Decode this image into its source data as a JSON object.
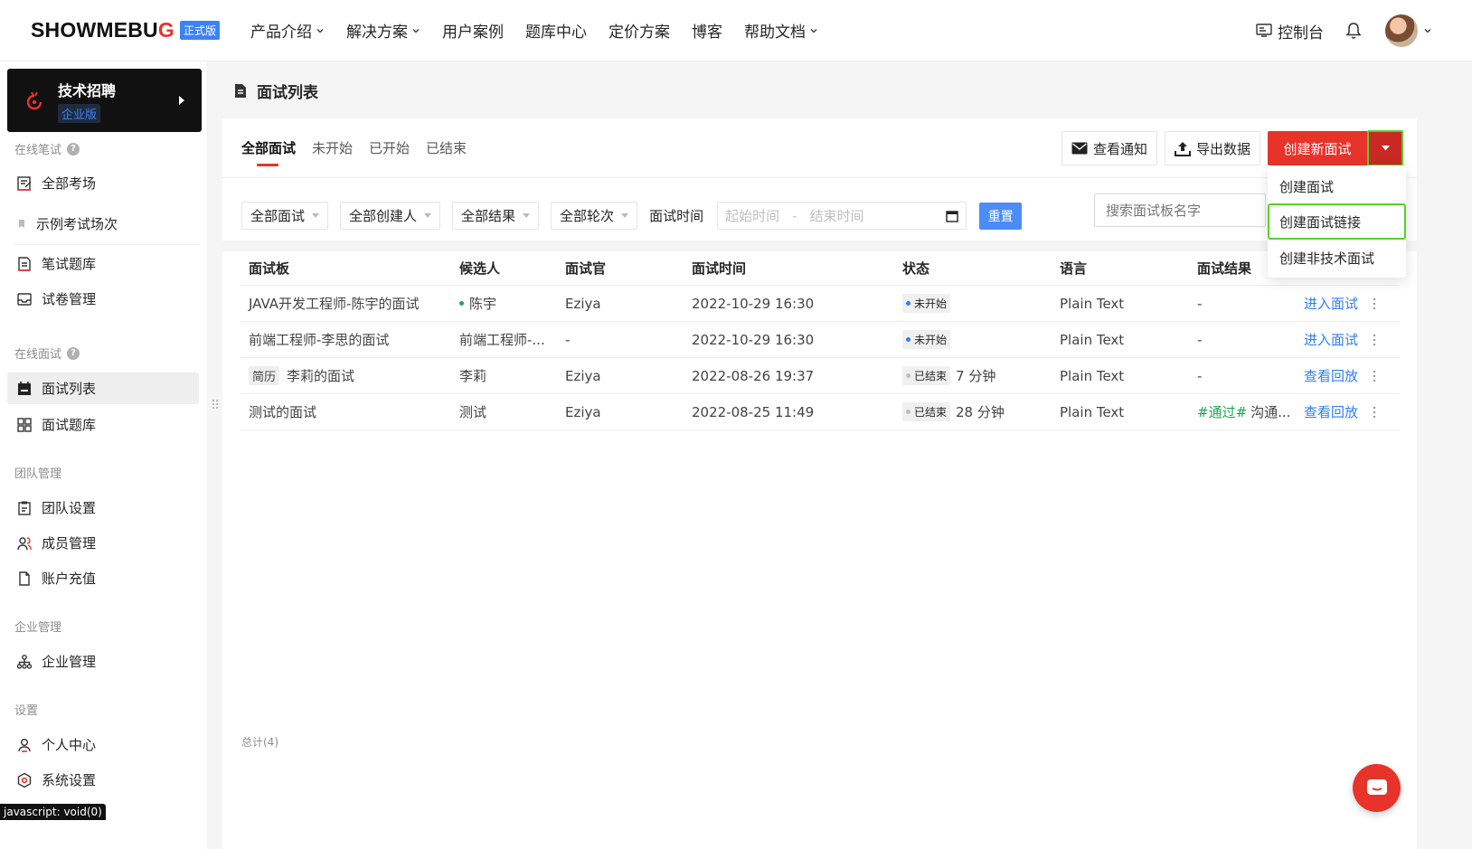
{
  "brand": {
    "logo_main": "SHOWMEBU",
    "logo_q": "G",
    "edition": "正式版"
  },
  "nav": [
    {
      "label": "产品介绍",
      "dropdown": true
    },
    {
      "label": "解决方案",
      "dropdown": true
    },
    {
      "label": "用户案例",
      "dropdown": false
    },
    {
      "label": "题库中心",
      "dropdown": false
    },
    {
      "label": "定价方案",
      "dropdown": false
    },
    {
      "label": "博客",
      "dropdown": false
    },
    {
      "label": "帮助文档",
      "dropdown": true
    }
  ],
  "header": {
    "console": "控制台"
  },
  "product": {
    "title": "技术招聘",
    "badge": "企业版"
  },
  "sidebar": {
    "written": "在线笔试",
    "written_items": [
      "全部考场",
      "示例考试场次",
      "笔试题库",
      "试卷管理"
    ],
    "interview": "在线面试",
    "interview_items": [
      "面试列表",
      "面试题库"
    ],
    "team": "团队管理",
    "team_items": [
      "团队设置",
      "成员管理",
      "账户充值"
    ],
    "enterprise": "企业管理",
    "enterprise_items": [
      "企业管理"
    ],
    "settings": "设置",
    "settings_items": [
      "个人中心",
      "系统设置"
    ]
  },
  "page": {
    "title": "面试列表"
  },
  "tabs": [
    "全部面试",
    "未开始",
    "已开始",
    "已结束"
  ],
  "toolbar": {
    "notify": "查看通知",
    "export": "导出数据",
    "create": "创建新面试"
  },
  "filters": {
    "all_interviews": "全部面试",
    "all_creators": "全部创建人",
    "all_results": "全部结果",
    "all_rounds": "全部轮次",
    "time_label": "面试时间",
    "start_placeholder": "起始时间",
    "sep": "-",
    "end_placeholder": "结束时间",
    "reset": "重置"
  },
  "search": {
    "placeholder": "搜索面试板名字"
  },
  "dropdown": [
    "创建面试",
    "创建面试链接",
    "创建非技术面试"
  ],
  "table": {
    "headers": [
      "面试板",
      "候选人",
      "面试官",
      "面试时间",
      "状态",
      "语言",
      "面试结果"
    ],
    "rows": [
      {
        "board": "JAVA开发工程师-陈宇的面试",
        "resume": "",
        "candidate": "陈宇",
        "candidate_dot": true,
        "interviewer": "Eziya",
        "time": "2022-10-29 16:30",
        "status": "未开始",
        "status_color": "#2f7ef5",
        "duration": "",
        "language": "Plain Text",
        "result_tag": "",
        "result": "-",
        "action": "进入面试"
      },
      {
        "board": "前端工程师-李思的面试",
        "resume": "",
        "candidate": "前端工程师-...",
        "candidate_dot": false,
        "interviewer": "-",
        "time": "2022-10-29 16:30",
        "status": "未开始",
        "status_color": "#2f7ef5",
        "duration": "",
        "language": "Plain Text",
        "result_tag": "",
        "result": "-",
        "action": "进入面试"
      },
      {
        "board": "李莉的面试",
        "resume": "简历",
        "candidate": "李莉",
        "candidate_dot": false,
        "interviewer": "Eziya",
        "time": "2022-08-26 19:37",
        "status": "已结束",
        "status_color": "#bfbfbf",
        "duration": "7 分钟",
        "language": "Plain Text",
        "result_tag": "",
        "result": "-",
        "action": "查看回放"
      },
      {
        "board": "测试的面试",
        "resume": "",
        "candidate": "测试",
        "candidate_dot": false,
        "interviewer": "Eziya",
        "time": "2022-08-25 11:49",
        "status": "已结束",
        "status_color": "#bfbfbf",
        "duration": "28 分钟",
        "language": "Plain Text",
        "result_tag": "#通过#",
        "result": "沟通...",
        "action": "查看回放"
      }
    ],
    "total": "总计(4)"
  },
  "status_bar": "javascript: void(0)",
  "colors": {
    "brand_red": "#e8332a",
    "link_blue": "#2f7ef5",
    "highlight_green": "#57d12b",
    "success_green": "#1aa850"
  }
}
